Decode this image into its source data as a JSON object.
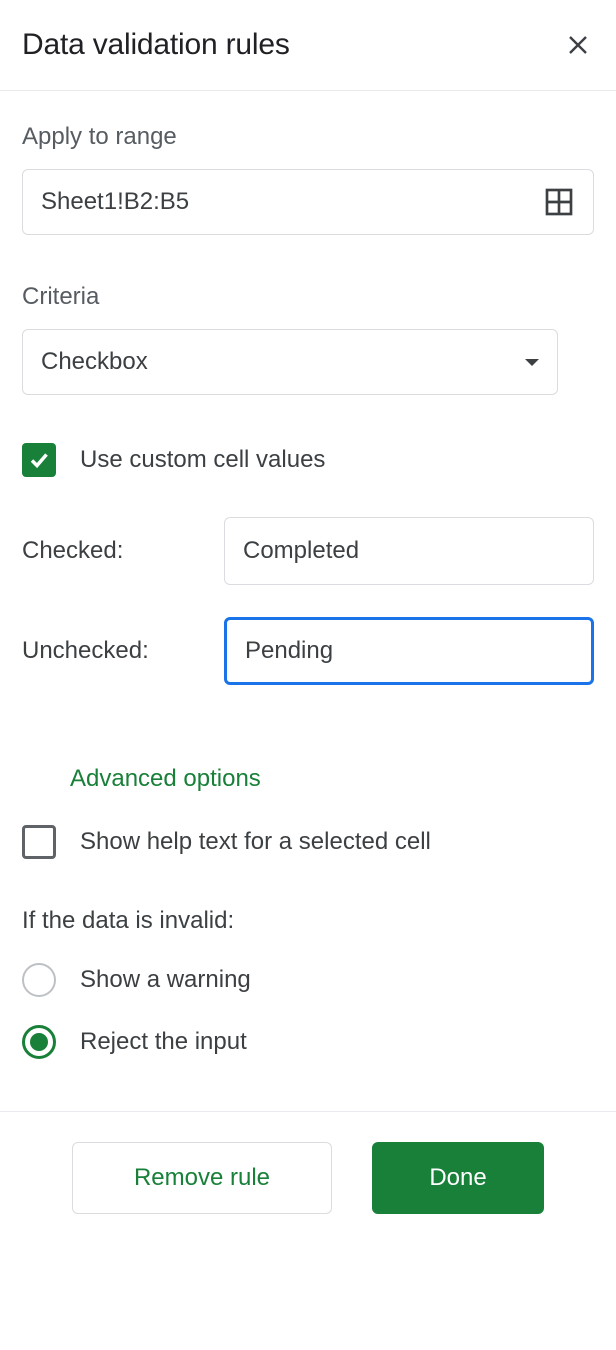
{
  "header": {
    "title": "Data validation rules"
  },
  "range": {
    "label": "Apply to range",
    "value": "Sheet1!B2:B5"
  },
  "criteria": {
    "label": "Criteria",
    "selected": "Checkbox"
  },
  "customValues": {
    "use_label": "Use custom cell values",
    "checked_label": "Checked:",
    "checked_value": "Completed",
    "unchecked_label": "Unchecked:",
    "unchecked_value": "Pending"
  },
  "advanced": {
    "label": "Advanced options"
  },
  "helpText": {
    "label": "Show help text for a selected cell"
  },
  "invalid": {
    "title": "If the data is invalid:",
    "warning_label": "Show a warning",
    "reject_label": "Reject the input"
  },
  "footer": {
    "remove_label": "Remove rule",
    "done_label": "Done"
  }
}
